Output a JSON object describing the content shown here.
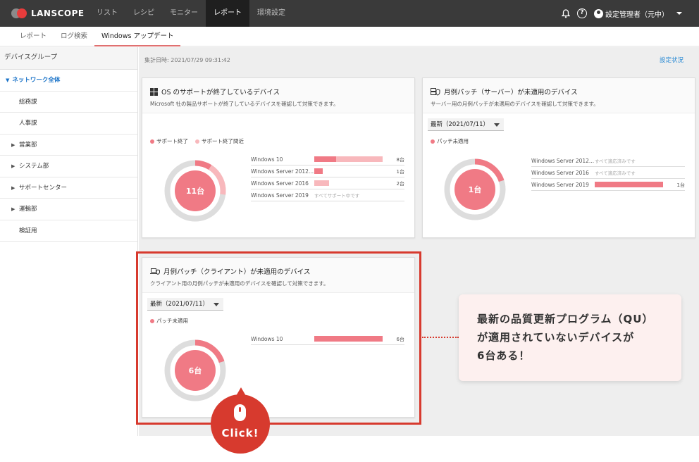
{
  "brand": {
    "name": "LANSCOPE"
  },
  "topnav": [
    "リスト",
    "レシピ",
    "モニター",
    "レポート",
    "環境設定"
  ],
  "topnav_active": 3,
  "top_right": {
    "help_glyph": "?",
    "user": "設定管理者（元中）"
  },
  "subnav": [
    "レポート",
    "ログ検索",
    "Windows アップデート"
  ],
  "subnav_active": 2,
  "sidebar": {
    "header": "デバイスグループ",
    "items": [
      {
        "label": "ネットワーク全体",
        "kind": "root"
      },
      {
        "label": "総務課",
        "kind": "leaf"
      },
      {
        "label": "人事課",
        "kind": "leaf"
      },
      {
        "label": "営業部",
        "kind": "branch"
      },
      {
        "label": "システム部",
        "kind": "branch"
      },
      {
        "label": "サポートセンター",
        "kind": "branch"
      },
      {
        "label": "運輸部",
        "kind": "branch"
      },
      {
        "label": "検証用",
        "kind": "leaf"
      }
    ]
  },
  "main": {
    "aggregated": "集計日時: 2021/07/29 09:31:42",
    "settings_link": "設定状況"
  },
  "colors": {
    "primary": "#f07a85",
    "light": "#f8b8bc",
    "ring": "#dddddd",
    "accent": "#d73a2e"
  },
  "cards": {
    "os": {
      "title": "OS のサポートが終了しているデバイス",
      "desc": "Microsoft 社の製品サポートが終了しているデバイスを確認して対策できます。",
      "legend": [
        "サポート終了",
        "サポート終了間近"
      ],
      "center": "11台",
      "ring": {
        "primary": 0.09,
        "light": 0.18
      },
      "rows": [
        {
          "label": "Windows 10",
          "primary": 0.32,
          "light": 0.68,
          "count": "8台"
        },
        {
          "label": "Windows Server 2012...",
          "primary": 0.12,
          "light": 0,
          "count": "1台"
        },
        {
          "label": "Windows Server 2016",
          "primary": 0,
          "light": 0.22,
          "count": "2台"
        },
        {
          "label": "Windows Server 2019",
          "note": "すべてサポート中です"
        }
      ]
    },
    "server": {
      "title": "月例パッチ（サーバー）が未適用のデバイス",
      "desc": "サーバー用の月例パッチが未適用のデバイスを確認して対策できます。",
      "select": "最新（2021/07/11）",
      "legend": [
        "パッチ未適用"
      ],
      "center": "1台",
      "ring": {
        "primary": 0.2,
        "light": 0
      },
      "rows": [
        {
          "label": "Windows Server 2012...",
          "note": "すべて適応済みです"
        },
        {
          "label": "Windows Server 2016",
          "note": "すべて適応済みです"
        },
        {
          "label": "Windows Server 2019",
          "primary": 1.0,
          "light": 0,
          "count": "1台"
        }
      ]
    },
    "client": {
      "title": "月例パッチ（クライアント）が未適用のデバイス",
      "desc": "クライアント用の月例パッチが未適用のデバイスを確認して対策できます。",
      "select": "最新（2021/07/11）",
      "legend": [
        "パッチ未適用"
      ],
      "center": "6台",
      "ring": {
        "primary": 0.2,
        "light": 0
      },
      "rows": [
        {
          "label": "Windows 10",
          "primary": 1.0,
          "light": 0,
          "count": "6台"
        }
      ]
    }
  },
  "callout": "最新の品質更新プログラム（QU）\nが適用されていないデバイスが\n6台ある！",
  "click_badge": "Click!"
}
